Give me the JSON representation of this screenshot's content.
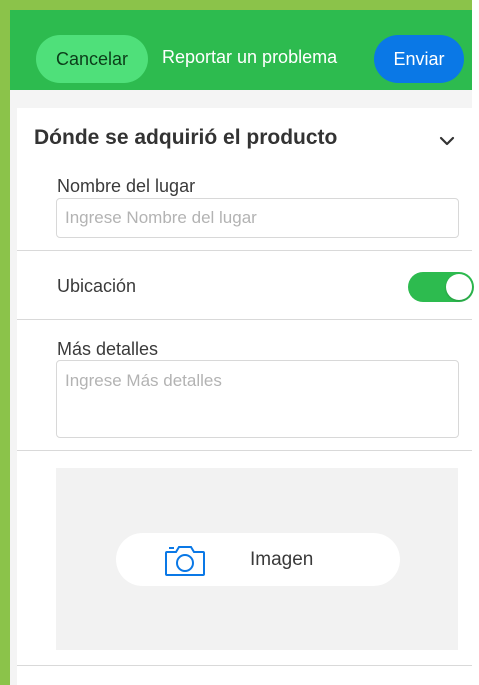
{
  "header": {
    "cancel_label": "Cancelar",
    "title": "Reportar un problema",
    "send_label": "Enviar"
  },
  "section": {
    "title": "Dónde se adquirió el producto",
    "chevron_icon": "chevron-down-icon"
  },
  "fields": {
    "place_name_label": "Nombre del lugar",
    "place_name_placeholder": "Ingrese Nombre del lugar",
    "place_name_value": "",
    "location_label": "Ubicación",
    "location_enabled": true,
    "details_label": "Más detalles",
    "details_placeholder": "Ingrese Más detalles",
    "details_value": ""
  },
  "image": {
    "label": "Imagen",
    "icon": "camera-icon"
  },
  "colors": {
    "header_green": "#2dbb4f",
    "cancel_green": "#4fe07a",
    "send_blue": "#0a78e6",
    "frame_green": "#8bc34a",
    "toggle_green": "#2dbb4f"
  }
}
